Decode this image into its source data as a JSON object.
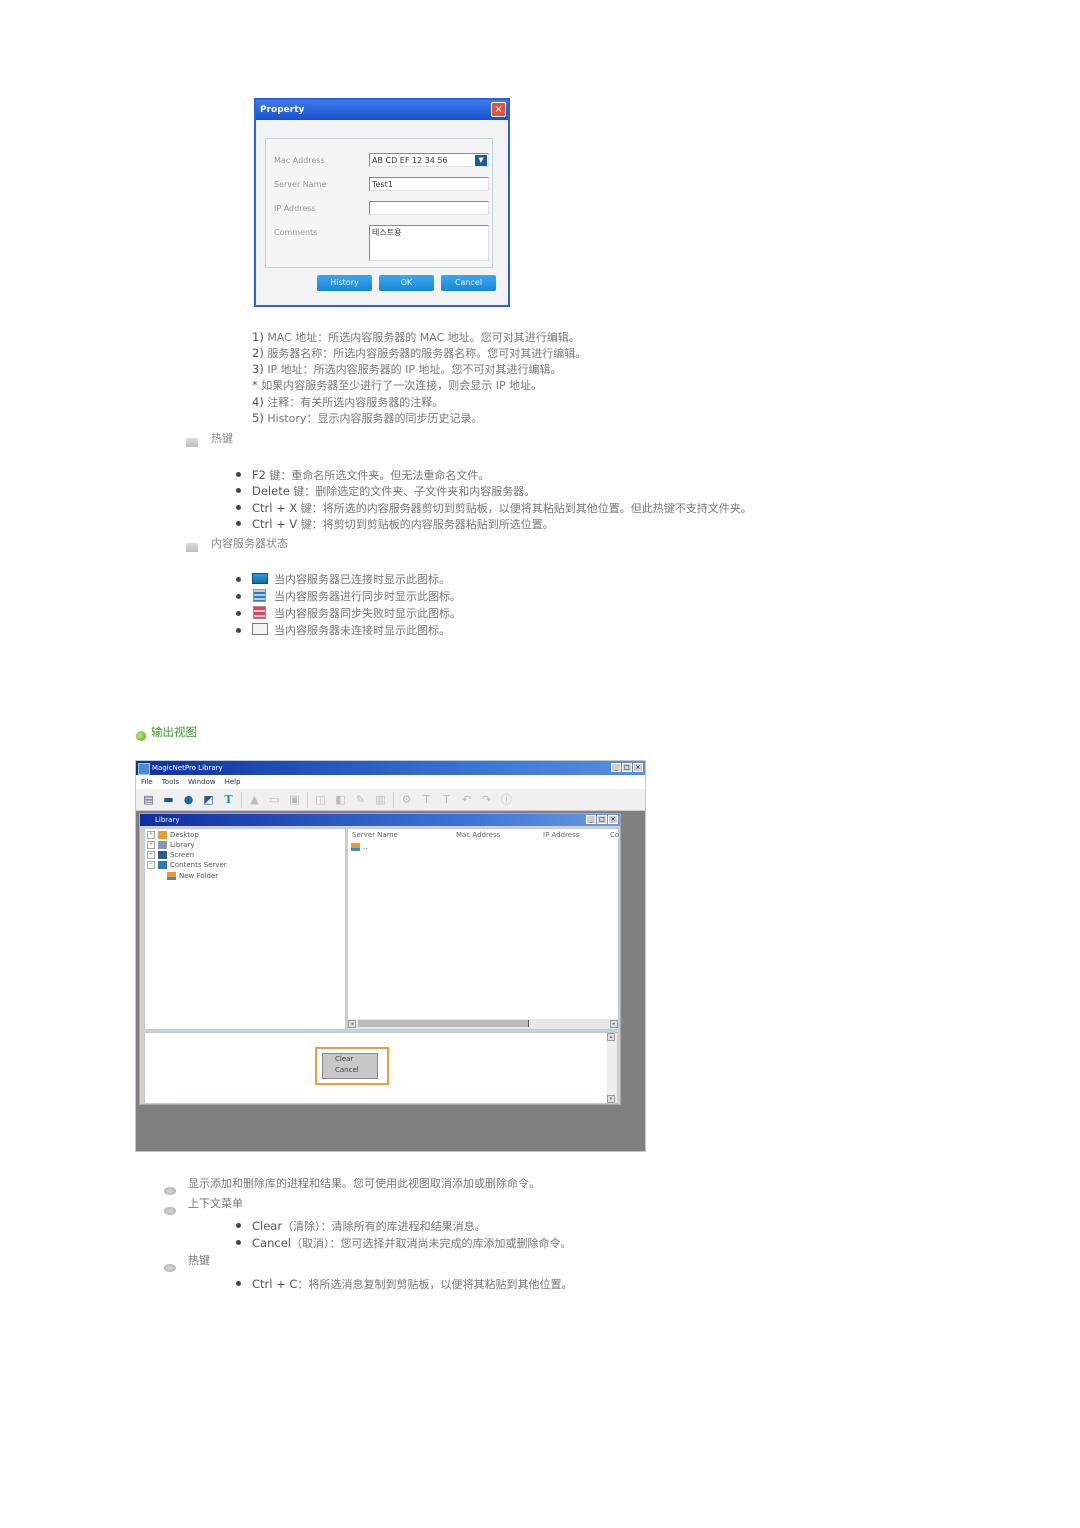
{
  "property_dialog": {
    "title": "Property",
    "close_icon": "×",
    "fields": [
      {
        "label": "Mac Address",
        "value": "AB CD EF 12 34 56"
      },
      {
        "label": "Server Name",
        "value": "Test1"
      },
      {
        "label": "IP Address",
        "value": ""
      },
      {
        "label": "Comments",
        "value": "테스트용"
      }
    ],
    "dropdown_icon": "▼",
    "buttons": {
      "history": "History",
      "ok": "OK",
      "cancel": "Cancel"
    }
  },
  "property_notes": [
    {
      "num": "1)",
      "text": "MAC 地址：所选内容服务器的 MAC 地址。您可对其进行编辑。"
    },
    {
      "num": "2)",
      "text": "服务器名称：所选内容服务器的服务器名称。您可对其进行编辑。"
    },
    {
      "num": "3)",
      "text": "IP 地址：所选内容服务器的 IP 地址。您不可对其进行编辑。"
    },
    {
      "num": "*",
      "text": "如果内容服务器至少进行了一次连接，则会显示 IP 地址。"
    },
    {
      "num": "4)",
      "text": "注释：有关所选内容服务器的注释。"
    },
    {
      "num": "5)",
      "text": "History：显示内容服务器的同步历史记录。"
    }
  ],
  "hotkeys_section": {
    "heading": "热键",
    "items": [
      {
        "key": "F2",
        "text": " 键：重命名所选文件夹。但无法重命名文件。"
      },
      {
        "key": "Delete",
        "text": " 键：删除选定的文件夹、子文件夹和内容服务器。"
      },
      {
        "key": "Ctrl + X",
        "text": " 键：将所选的内容服务器剪切到剪贴板，以便将其粘贴到其他位置。但此热键不支持文件夹。"
      },
      {
        "key": "Ctrl + V",
        "text": " 键：将剪切到剪贴板的内容服务器粘贴到所选位置。"
      }
    ]
  },
  "status_section": {
    "heading": "内容服务器状态",
    "items": [
      {
        "icon": "connected-icon",
        "text": "当内容服务器已连接时显示此图标。"
      },
      {
        "icon": "syncing-icon",
        "text": "当内容服务器进行同步时显示此图标。"
      },
      {
        "icon": "sync-failed-icon",
        "text": "当内容服务器同步失败时显示此图标。"
      },
      {
        "icon": "disconnected-icon",
        "text": "当内容服务器未连接时显示此图标。"
      }
    ]
  },
  "output_view": {
    "heading": "输出视图",
    "window": {
      "title": "MagicNetPro Library",
      "controls": [
        "_",
        "□",
        "×"
      ],
      "menu": [
        "File",
        "Tools",
        "Window",
        "Help"
      ],
      "child_title": "Library",
      "tree": [
        "Desktop",
        "Library",
        "Screen",
        "Contents Server",
        "New Folder"
      ],
      "columns": [
        "Server Name",
        "Mac Address",
        "IP Address",
        "Co"
      ],
      "list_item": "..",
      "context_menu": [
        "Clear",
        "Cancel"
      ]
    },
    "description": "显示添加和删除库的进程和结果。您可使用此视图取消添加或删除命令。",
    "context_menu_section": {
      "heading": "上下文菜单",
      "items": [
        {
          "key": "Clear",
          "text": "（清除）：清除所有的库进程和结果消息。"
        },
        {
          "key": "Cancel",
          "text": "（取消）：您可选择并取消尚未完成的库添加或删除命令。"
        }
      ]
    },
    "hotkeys": {
      "heading": "热键",
      "items": [
        {
          "key": "Ctrl + C",
          "text": "：将所选消息复制到剪贴板，以便将其粘贴到其他位置。"
        }
      ]
    }
  }
}
